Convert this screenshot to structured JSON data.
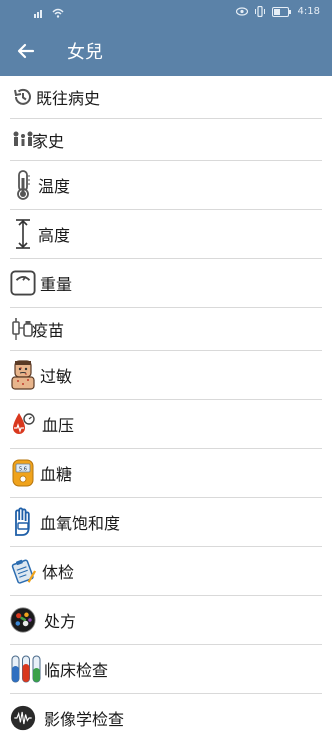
{
  "status": {
    "time": "4:18"
  },
  "appbar": {
    "title": "女兒"
  },
  "items": [
    {
      "label": "既往病史",
      "icon": "history-icon"
    },
    {
      "label": "家史",
      "icon": "family-icon"
    },
    {
      "label": "温度",
      "icon": "thermometer-icon"
    },
    {
      "label": "高度",
      "icon": "height-icon"
    },
    {
      "label": "重量",
      "icon": "scale-icon"
    },
    {
      "label": "疫苗",
      "icon": "syringe-icon"
    },
    {
      "label": "过敏",
      "icon": "allergy-icon"
    },
    {
      "label": "血压",
      "icon": "blood-pressure-icon"
    },
    {
      "label": "血糖",
      "icon": "glucometer-icon"
    },
    {
      "label": "血氧饱和度",
      "icon": "oximeter-hand-icon"
    },
    {
      "label": "体检",
      "icon": "checkup-clipboard-icon"
    },
    {
      "label": "处方",
      "icon": "prescription-pills-icon"
    },
    {
      "label": "临床检查",
      "icon": "test-tubes-icon"
    },
    {
      "label": "影像学检查",
      "icon": "imaging-icon"
    }
  ],
  "colors": {
    "bar": "#5b82a8",
    "divider": "#d9d9d9"
  }
}
